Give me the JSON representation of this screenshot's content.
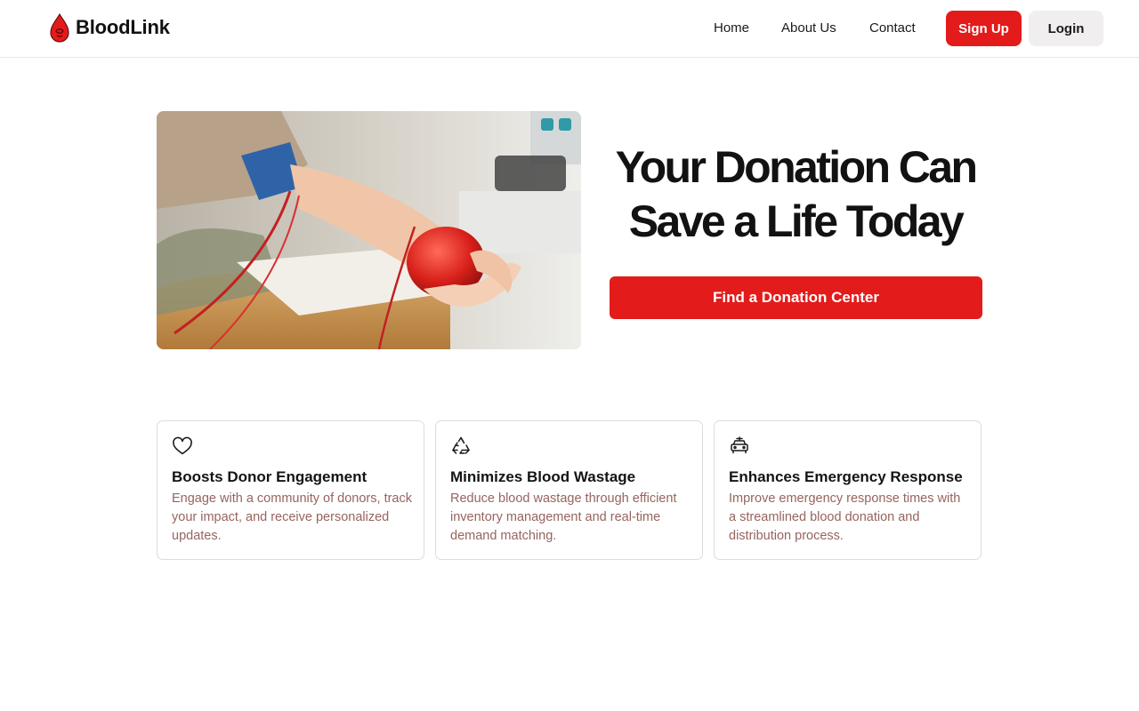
{
  "header": {
    "brand": "BloodLink",
    "nav": [
      {
        "label": "Home"
      },
      {
        "label": "About Us"
      },
      {
        "label": "Contact"
      }
    ],
    "signup_label": "Sign Up",
    "login_label": "Login"
  },
  "hero": {
    "title": "Your Donation Can Save a Life Today",
    "cta_label": "Find a Donation Center",
    "image_icon": "blood-donation-photo"
  },
  "features": [
    {
      "icon": "heart-icon",
      "title": "Boosts Donor Engagement",
      "description": "Engage with a community of donors, track your impact, and receive personalized updates."
    },
    {
      "icon": "recycle-icon",
      "title": "Minimizes Blood Wastage",
      "description": "Reduce blood wastage through efficient inventory management and real-time demand matching."
    },
    {
      "icon": "ambulance-icon",
      "title": "Enhances Emergency Response",
      "description": "Improve emergency response times with a streamlined blood donation and distribution process."
    }
  ],
  "colors": {
    "accent": "#e31b1b",
    "muted_text": "#96645f",
    "login_bg": "#f0eeee"
  }
}
